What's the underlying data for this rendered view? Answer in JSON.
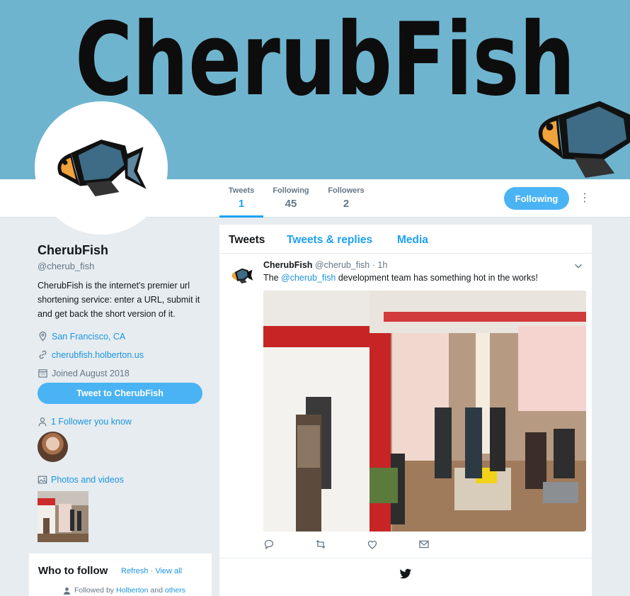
{
  "banner": {
    "title": "CherubFish"
  },
  "nav": {
    "stats": [
      {
        "label": "Tweets",
        "value": "1"
      },
      {
        "label": "Following",
        "value": "45"
      },
      {
        "label": "Followers",
        "value": "2"
      }
    ],
    "follow_button": "Following",
    "more_icon": "more-vertical-icon"
  },
  "profile": {
    "name": "CherubFish",
    "handle": "@cherub_fish",
    "bio": "CherubFish is the internet's premier url shortening service: enter a URL, submit it and get back the short version of it.",
    "location": "San Francisco, CA",
    "website": "cherubfish.holberton.us",
    "joined": "Joined August 2018",
    "tweet_to_button": "Tweet to CherubFish",
    "followers_you_know": "1 Follower you know",
    "photos_and_videos": "Photos and videos"
  },
  "who_to_follow": {
    "title": "Who to follow",
    "refresh": "Refresh",
    "separator": "·",
    "view_all": "View all",
    "followed_by": "Followed by",
    "followed_by_account": "Holberton",
    "and": "and",
    "others": "others"
  },
  "timeline": {
    "tabs": [
      "Tweets",
      "Tweets & replies",
      "Media"
    ],
    "tweet": {
      "name": "CherubFish",
      "handle": "@cherub_fish",
      "time": "· 1h",
      "text_before": "The",
      "mention": "@cherub_fish",
      "text_after": "development team has something hot in the works!"
    }
  },
  "colors": {
    "accent": "#1da1f2",
    "button": "#4ab3f4",
    "banner": "#6fb4cf"
  }
}
